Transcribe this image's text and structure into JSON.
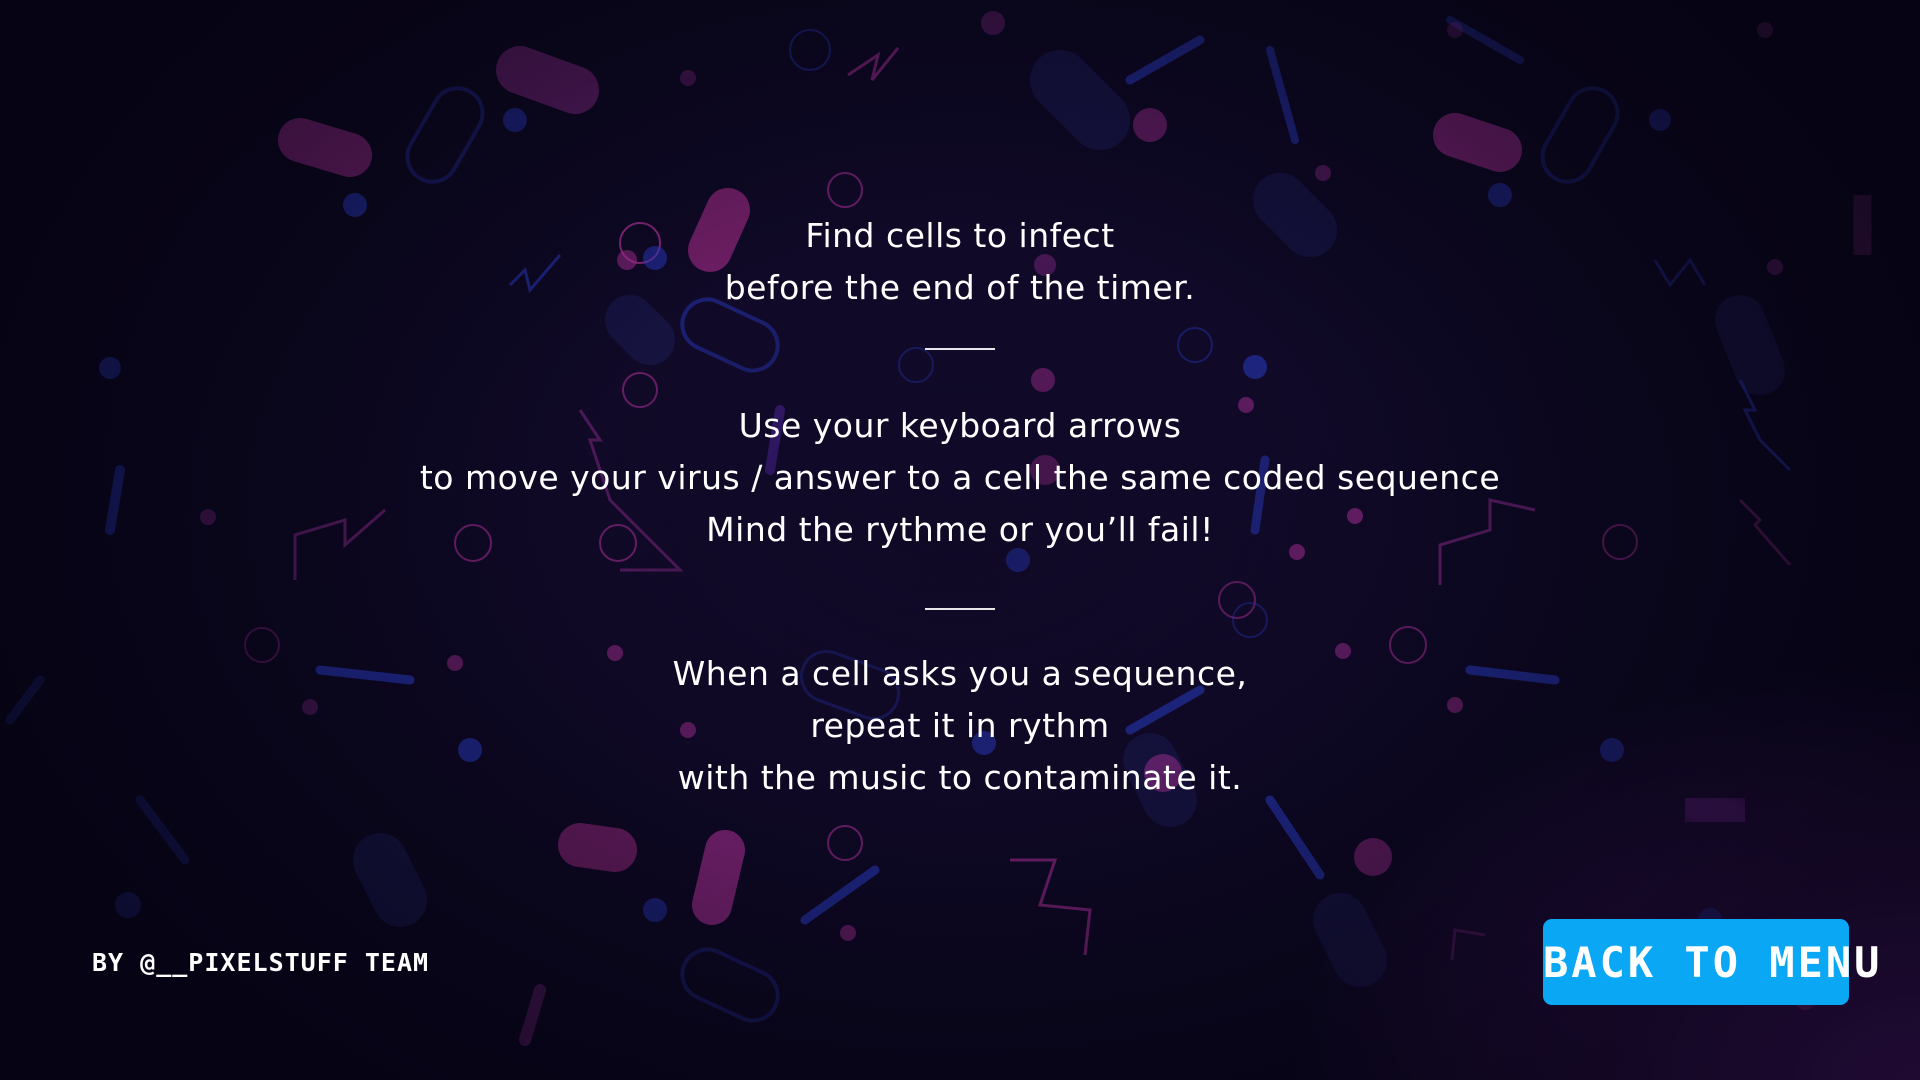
{
  "instructions": {
    "section_1": {
      "lines": [
        "Find cells to infect",
        "before the end of the timer."
      ]
    },
    "section_2": {
      "lines": [
        "Use your keyboard arrows",
        "to move your virus / answer to a cell the same coded sequence",
        "Mind the rythme or you’ll fail!"
      ]
    },
    "section_3": {
      "lines": [
        "When a cell asks you a sequence,",
        "repeat it in rythm",
        "with the music to contaminate it."
      ]
    }
  },
  "footer": {
    "credit": "BY @__PIXELSTUFF TEAM",
    "back_button_label": "BACK TO MENU"
  },
  "colors": {
    "background": "#0c0720",
    "button": "#0aa7f5",
    "text": "#ffffff",
    "accent_magenta": "#b0309a",
    "accent_blue": "#2a3cc8"
  },
  "background_shapes": [
    "pill-shape",
    "circle-shape",
    "ring-shape",
    "zigzag-shape",
    "line-shape"
  ]
}
